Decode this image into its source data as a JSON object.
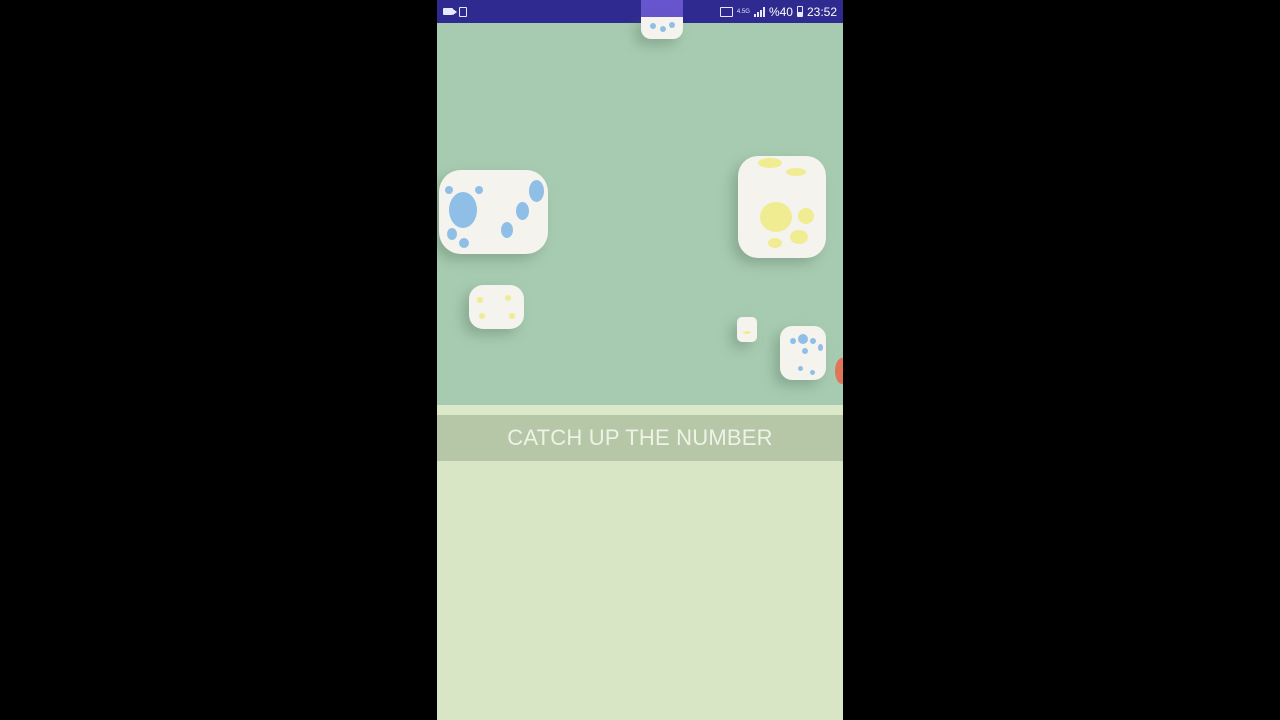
{
  "status_bar": {
    "network_label": "4.5G",
    "battery_percent": "%40",
    "time": "23:52",
    "icons": [
      "video-camera-icon",
      "document-icon",
      "cast-icon",
      "signal-icon",
      "battery-icon"
    ]
  },
  "game": {
    "title": "CATCH UP THE NUMBER"
  },
  "colors": {
    "status_bar": "#2e2a8f",
    "game_area": "#a7cbb1",
    "title_bar": "#b5c7a7",
    "lower_area": "#d8e6c6",
    "pip_blue": "#8fbfe6",
    "pip_yellow": "#f0ec92",
    "accent_red": "#e07657"
  }
}
